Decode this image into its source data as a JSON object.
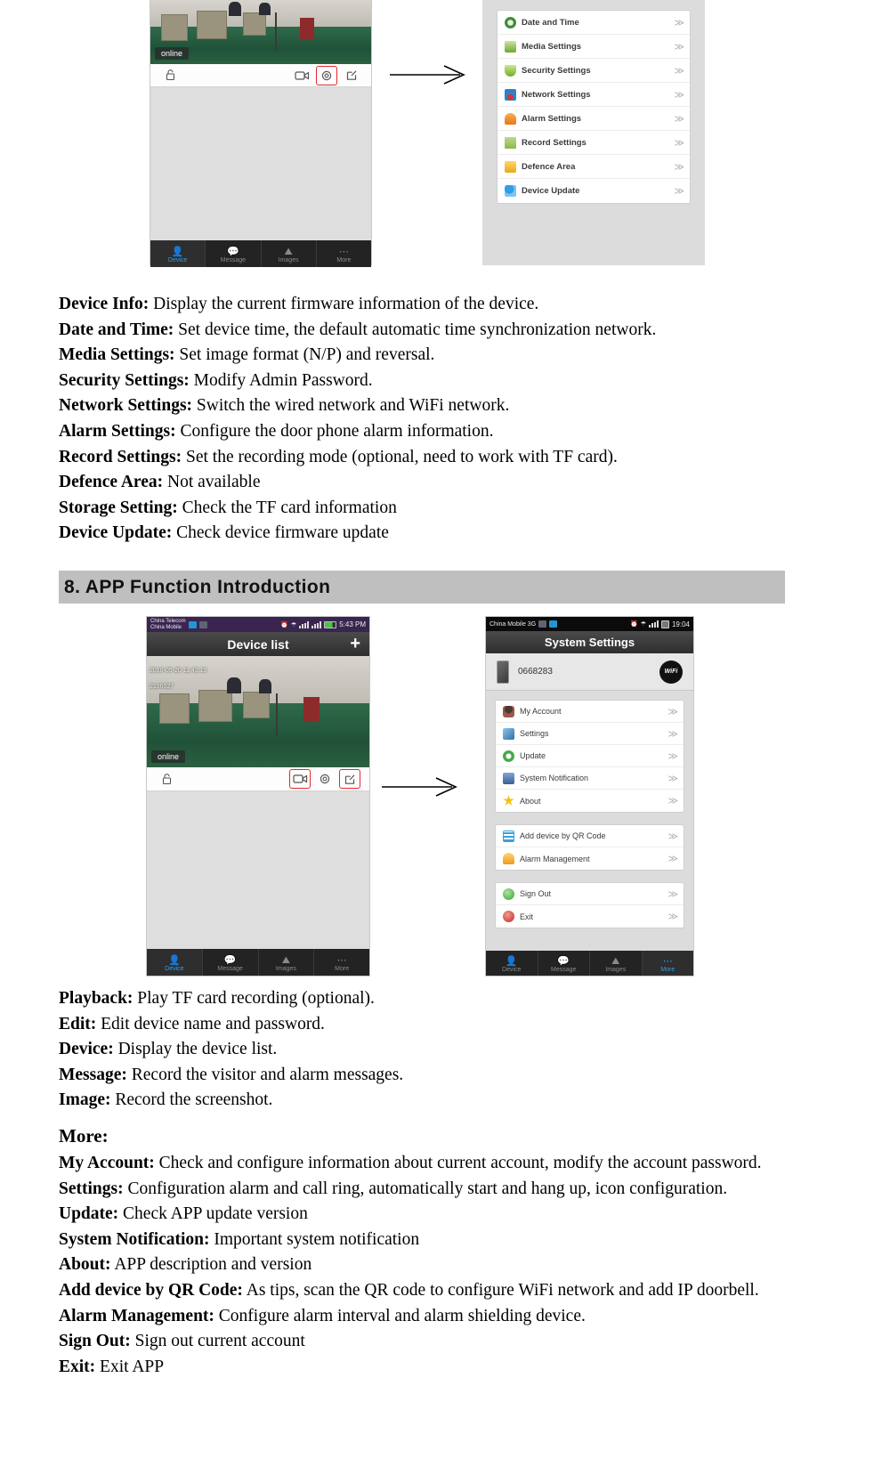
{
  "figure_top": {
    "phone": {
      "camera": {
        "online_label": "online"
      },
      "toolbar_icons": [
        "lock-icon",
        "video-camera-icon",
        "gear-icon",
        "edit-icon"
      ],
      "highlighted_icon": "gear-icon",
      "tabs": [
        {
          "label": "Device",
          "icon": "person-icon",
          "active": true
        },
        {
          "label": "Message",
          "icon": "chat-icon",
          "active": false
        },
        {
          "label": "Images",
          "icon": "picture-icon",
          "active": false
        },
        {
          "label": "More",
          "icon": "ellipsis-icon",
          "active": false
        }
      ]
    },
    "settings_list": [
      {
        "label": "Date and Time",
        "icon": "clock-icon",
        "icon_color": "#3e8c3e",
        "chevron": "≫"
      },
      {
        "label": "Media Settings",
        "icon": "media-icon",
        "icon_color": "#6aa832",
        "chevron": "≫"
      },
      {
        "label": "Security Settings",
        "icon": "shield-icon",
        "icon_color": "#8cc63f",
        "chevron": "≫"
      },
      {
        "label": "Network Settings",
        "icon": "network-icon",
        "icon_color": "#2f7fd0",
        "chevron": "≫"
      },
      {
        "label": "Alarm Settings",
        "icon": "bell-icon",
        "icon_color": "#e8761a",
        "chevron": "≫"
      },
      {
        "label": "Record Settings",
        "icon": "folder-icon",
        "icon_color": "#8ab84a",
        "chevron": "≫"
      },
      {
        "label": "Defence Area",
        "icon": "lock-icon",
        "icon_color": "#f0b323",
        "chevron": "≫"
      },
      {
        "label": "Device Update",
        "icon": "user-sync-icon",
        "icon_color": "#2f9fe8",
        "chevron": "≫"
      }
    ]
  },
  "glossary_top": [
    {
      "term": "Device Info:",
      "desc": "Display the current firmware information of the device."
    },
    {
      "term": "Date and Time:",
      "desc": "Set device time, the default automatic time synchronization network."
    },
    {
      "term": "Media Settings:",
      "desc": "Set image format (N/P) and reversal."
    },
    {
      "term": "Security Settings:",
      "desc": "Modify Admin Password."
    },
    {
      "term": "Network Settings:",
      "desc": "Switch the wired network and WiFi network."
    },
    {
      "term": "Alarm Settings:",
      "desc": "Configure the door phone alarm information."
    },
    {
      "term": "Record Settings:",
      "desc": "Set the recording mode (optional, need to work with TF card)."
    },
    {
      "term": "Defence Area:",
      "desc": "Not available"
    },
    {
      "term": "Storage Setting:",
      "desc": "Check the TF card information"
    },
    {
      "term": "Device Update:",
      "desc": "Check device firmware update"
    }
  ],
  "section_heading": "8. APP Function Introduction",
  "figure_bottom": {
    "phone_left": {
      "statusbar": {
        "carrier": "China Telecom\nChina Mobile",
        "time": "5:43 PM",
        "icons": [
          "alarm-icon",
          "wifi-icon",
          "4g-signal-icon",
          "3g-signal-icon",
          "battery-icon"
        ]
      },
      "title": "Device list",
      "add_label": "+",
      "camera": {
        "timestamp": "2018-05-20   11:43:15",
        "device_id": "2196927",
        "online_label": "online"
      },
      "toolbar_icons": [
        "lock-icon",
        "video-camera-icon",
        "gear-icon",
        "edit-icon"
      ],
      "highlighted_icons": [
        "video-camera-icon",
        "edit-icon"
      ],
      "tabs": [
        {
          "label": "Device",
          "icon": "person-icon",
          "active": true
        },
        {
          "label": "Message",
          "icon": "chat-icon",
          "active": false
        },
        {
          "label": "Images",
          "icon": "picture-icon",
          "active": false
        },
        {
          "label": "More",
          "icon": "ellipsis-icon",
          "active": false
        }
      ]
    },
    "phone_right": {
      "statusbar": {
        "carrier": "China Mobile 3G",
        "time": "19:04",
        "icons": [
          "alarm-icon",
          "wifi-icon",
          "signal-icon",
          "battery-icon"
        ]
      },
      "title": "System Settings",
      "device_id": "0668283",
      "wifi_badge": "WiFi",
      "groups": [
        [
          {
            "label": "My Account",
            "icon": "user-icon",
            "icon_color": "#8b5a4a",
            "chevron": "≫"
          },
          {
            "label": "Settings",
            "icon": "gear-icon",
            "icon_color": "#3c7fb1",
            "chevron": "≫"
          },
          {
            "label": "Update",
            "icon": "refresh-icon",
            "icon_color": "#49a94b",
            "chevron": "≫"
          },
          {
            "label": "System Notification",
            "icon": "monitor-icon",
            "icon_color": "#4a6d9c",
            "chevron": "≫"
          },
          {
            "label": "About",
            "icon": "star-icon",
            "icon_color": "#f2c419",
            "chevron": "≫"
          }
        ],
        [
          {
            "label": "Add device by QR Code",
            "icon": "qr-code-icon",
            "icon_color": "#3aa0dd",
            "chevron": "≫"
          },
          {
            "label": "Alarm Management",
            "icon": "bell-icon",
            "icon_color": "#f0a52a",
            "chevron": "≫"
          }
        ],
        [
          {
            "label": "Sign Out",
            "icon": "signout-icon",
            "icon_color": "#5ec14e",
            "chevron": "≫"
          },
          {
            "label": "Exit",
            "icon": "exit-icon",
            "icon_color": "#d8342b",
            "chevron": "≫"
          }
        ]
      ],
      "tabs": [
        {
          "label": "Device",
          "icon": "person-icon",
          "active": false
        },
        {
          "label": "Message",
          "icon": "chat-icon",
          "active": false
        },
        {
          "label": "Images",
          "icon": "picture-icon",
          "active": false
        },
        {
          "label": "More",
          "icon": "ellipsis-icon",
          "active": true
        }
      ]
    }
  },
  "glossary_bottom_1": [
    {
      "term": "Playback:",
      "desc": "Play TF card recording (optional)."
    },
    {
      "term": "Edit:",
      "desc": "Edit device name and password."
    },
    {
      "term": "Device:",
      "desc": "Display the device list."
    },
    {
      "term": "Message:",
      "desc": "Record the visitor and alarm messages."
    },
    {
      "term": "Image:",
      "desc": "Record the screenshot."
    }
  ],
  "more_heading": "More:",
  "glossary_bottom_2": [
    {
      "term": "My Account:",
      "desc": "Check and configure information about current account, modify the account password."
    },
    {
      "term": "Settings:",
      "desc": "Configuration alarm and call ring, automatically start and hang up, icon configuration."
    },
    {
      "term": "Update:",
      "desc": "Check APP update version"
    },
    {
      "term": "System Notification:",
      "desc": "Important system notification"
    },
    {
      "term": "About:",
      "desc": "APP description and version"
    },
    {
      "term": "Add device by QR Code:",
      "desc": "As tips, scan the QR code to configure WiFi network and add IP doorbell."
    },
    {
      "term": "Alarm Management:",
      "desc": "Configure alarm interval and alarm shielding device."
    },
    {
      "term": "Sign Out:",
      "desc": "Sign out current account"
    },
    {
      "term": "Exit:",
      "desc": "Exit APP"
    }
  ],
  "colors": {
    "section_band": "#bfbfbf",
    "highlight_red": "#e8262d",
    "tab_active": "#2f9fe8",
    "panel_gray": "#dcdcdc"
  }
}
